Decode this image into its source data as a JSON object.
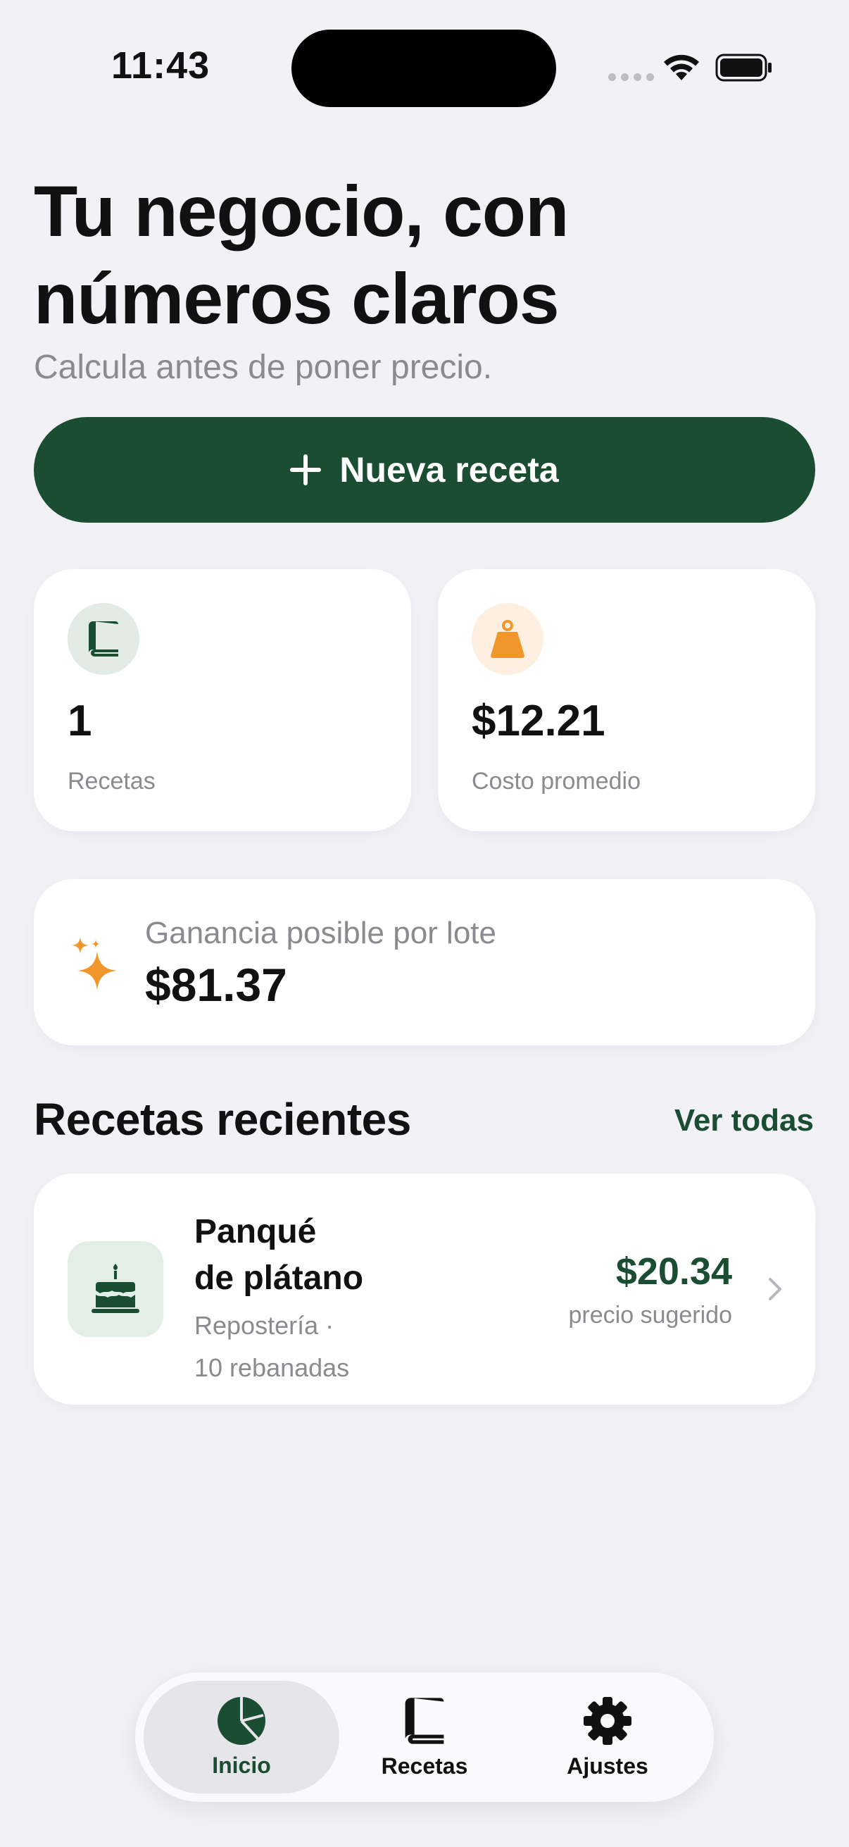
{
  "status_bar": {
    "time": "11:43"
  },
  "header": {
    "title": "Tu negocio, con números claros",
    "subtitle": "Calcula antes de poner precio."
  },
  "primary_action": {
    "label": "Nueva receta",
    "icon": "plus-icon"
  },
  "stats": [
    {
      "value": "1",
      "label": "Recetas",
      "icon": "book-icon",
      "accent": "#1b4d32"
    },
    {
      "value": "$12.21",
      "label": "Costo promedio",
      "icon": "weight-icon",
      "accent": "#f0962a"
    }
  ],
  "profit": {
    "label": "Ganancia posible por lote",
    "value": "$81.37",
    "icon": "sparkles-icon"
  },
  "recent": {
    "title": "Recetas recientes",
    "see_all": "Ver todas",
    "items": [
      {
        "name_line1": "Panqué",
        "name_line2": "de plátano",
        "meta_line1": "Repostería ·",
        "meta_line2": "10 rebanadas",
        "price": "$20.34",
        "price_label": "precio sugerido",
        "icon": "cake-icon"
      }
    ]
  },
  "tab_bar": {
    "tabs": [
      {
        "label": "Inicio",
        "icon": "chart-pie-icon",
        "active": true
      },
      {
        "label": "Recetas",
        "icon": "book-icon",
        "active": false
      },
      {
        "label": "Ajustes",
        "icon": "gear-icon",
        "active": false
      }
    ]
  },
  "colors": {
    "brand_green": "#1b4d32",
    "accent_orange": "#f0962a",
    "background": "#f2f1f6"
  }
}
